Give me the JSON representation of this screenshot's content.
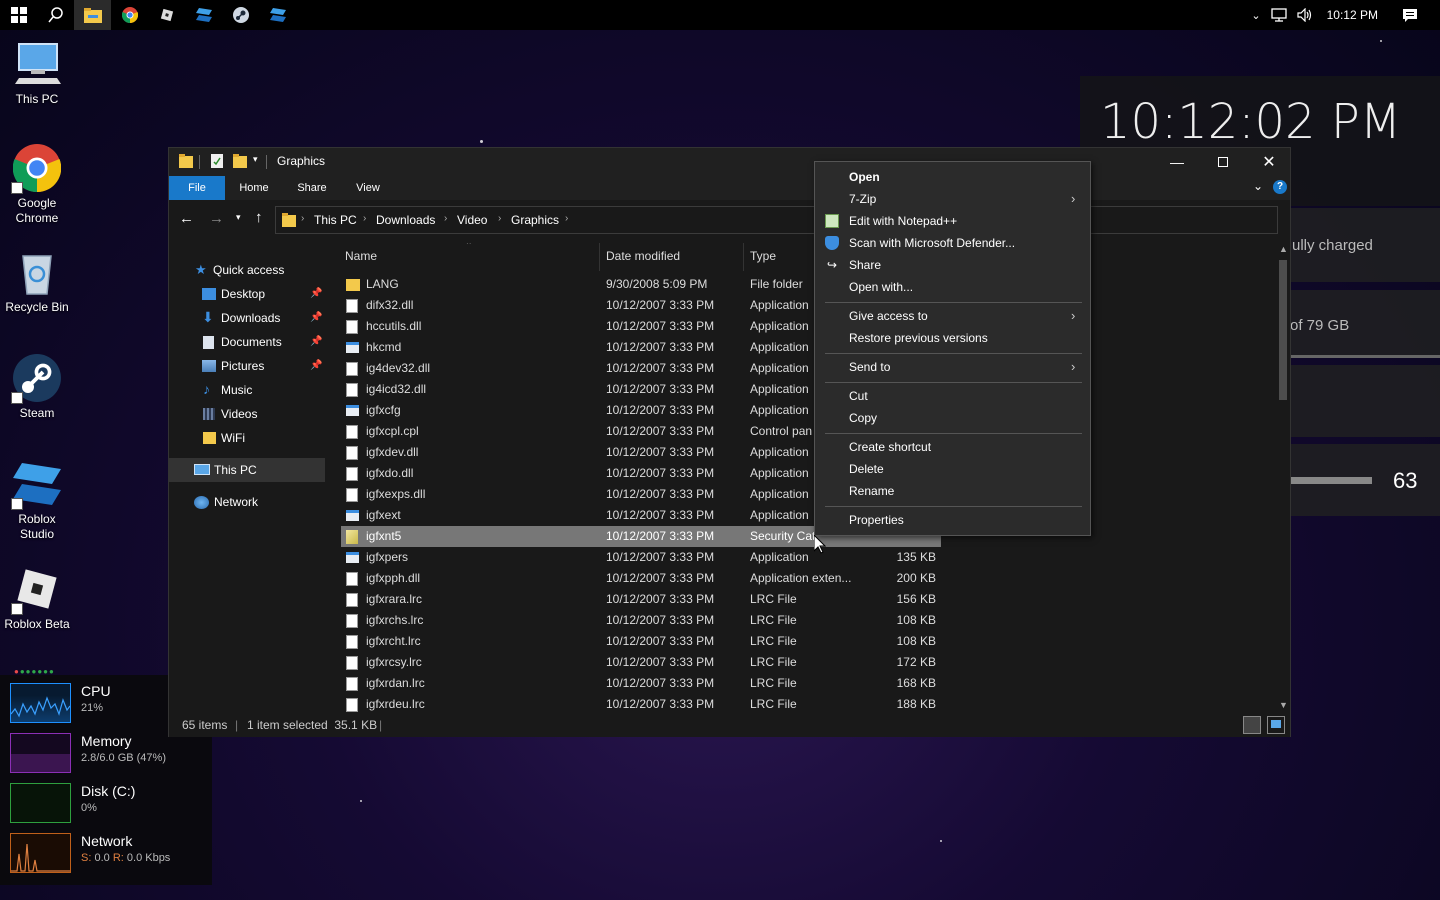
{
  "taskbar": {
    "time": "10:12 PM",
    "apps": [
      "start-icon",
      "search-icon",
      "file-explorer-icon",
      "chrome-icon",
      "roblox-icon",
      "roblox-studio-icon",
      "steam-icon",
      "roblox-studio-icon"
    ]
  },
  "desktop": {
    "icons": [
      {
        "label": "This PC"
      },
      {
        "label": "Google Chrome"
      },
      {
        "label": "Recycle Bin"
      },
      {
        "label": "Steam"
      },
      {
        "label": "Roblox Studio"
      },
      {
        "label": "Roblox Beta"
      }
    ]
  },
  "clock_widget": {
    "time": "10:12:02 PM",
    "battery_text": "ully charged",
    "storage_text": "of 79 GB",
    "volume_value": "63"
  },
  "resmon": {
    "cpu": {
      "name": "CPU",
      "value": "21%",
      "color": "#1e90ff"
    },
    "memory": {
      "name": "Memory",
      "value": "2.8/6.0 GB (47%)",
      "color": "#8b2fb5"
    },
    "disk": {
      "name": "Disk (C:)",
      "value": "0%",
      "color": "#2e9f3e"
    },
    "network": {
      "name": "Network",
      "value_s_label": "S:",
      "value_s": "0.0",
      "value_r_label": "R:",
      "value_r": "0.0 Kbps",
      "color": "#c0601a"
    }
  },
  "explorer": {
    "title": "Graphics",
    "ribbon_tabs": [
      "File",
      "Home",
      "Share",
      "View"
    ],
    "breadcrumb": [
      "This PC",
      "Downloads",
      "Video",
      "Graphics"
    ],
    "nav": {
      "quick_access": "Quick access",
      "items": [
        "Desktop",
        "Downloads",
        "Documents",
        "Pictures",
        "Music",
        "Videos",
        "WiFi"
      ],
      "this_pc": "This PC",
      "network": "Network"
    },
    "columns": {
      "name": "Name",
      "date": "Date modified",
      "type": "Type"
    },
    "files": [
      {
        "name": "LANG",
        "date": "9/30/2008 5:09 PM",
        "type": "File folder",
        "size": "",
        "kind": "folder"
      },
      {
        "name": "difx32.dll",
        "date": "10/12/2007 3:33 PM",
        "type": "Application",
        "size": "",
        "kind": "dll"
      },
      {
        "name": "hccutils.dll",
        "date": "10/12/2007 3:33 PM",
        "type": "Application",
        "size": "",
        "kind": "dll"
      },
      {
        "name": "hkcmd",
        "date": "10/12/2007 3:33 PM",
        "type": "Application",
        "size": "",
        "kind": "exe"
      },
      {
        "name": "ig4dev32.dll",
        "date": "10/12/2007 3:33 PM",
        "type": "Application",
        "size": "",
        "kind": "dll"
      },
      {
        "name": "ig4icd32.dll",
        "date": "10/12/2007 3:33 PM",
        "type": "Application",
        "size": "",
        "kind": "dll"
      },
      {
        "name": "igfxcfg",
        "date": "10/12/2007 3:33 PM",
        "type": "Application",
        "size": "",
        "kind": "exe"
      },
      {
        "name": "igfxcpl.cpl",
        "date": "10/12/2007 3:33 PM",
        "type": "Control pan",
        "size": "",
        "kind": "dll"
      },
      {
        "name": "igfxdev.dll",
        "date": "10/12/2007 3:33 PM",
        "type": "Application",
        "size": "",
        "kind": "dll"
      },
      {
        "name": "igfxdo.dll",
        "date": "10/12/2007 3:33 PM",
        "type": "Application",
        "size": "",
        "kind": "dll"
      },
      {
        "name": "igfxexps.dll",
        "date": "10/12/2007 3:33 PM",
        "type": "Application",
        "size": "",
        "kind": "dll"
      },
      {
        "name": "igfxext",
        "date": "10/12/2007 3:33 PM",
        "type": "Application",
        "size": "",
        "kind": "exe"
      },
      {
        "name": "igfxnt5",
        "date": "10/12/2007 3:33 PM",
        "type": "Security Cat",
        "size": "",
        "kind": "cat",
        "selected": true
      },
      {
        "name": "igfxpers",
        "date": "10/12/2007 3:33 PM",
        "type": "Application",
        "size": "135 KB",
        "kind": "exe"
      },
      {
        "name": "igfxpph.dll",
        "date": "10/12/2007 3:33 PM",
        "type": "Application exten...",
        "size": "200 KB",
        "kind": "dll"
      },
      {
        "name": "igfxrara.lrc",
        "date": "10/12/2007 3:33 PM",
        "type": "LRC File",
        "size": "156 KB",
        "kind": "file"
      },
      {
        "name": "igfxrchs.lrc",
        "date": "10/12/2007 3:33 PM",
        "type": "LRC File",
        "size": "108 KB",
        "kind": "file"
      },
      {
        "name": "igfxrcht.lrc",
        "date": "10/12/2007 3:33 PM",
        "type": "LRC File",
        "size": "108 KB",
        "kind": "file"
      },
      {
        "name": "igfxrcsy.lrc",
        "date": "10/12/2007 3:33 PM",
        "type": "LRC File",
        "size": "172 KB",
        "kind": "file"
      },
      {
        "name": "igfxrdan.lrc",
        "date": "10/12/2007 3:33 PM",
        "type": "LRC File",
        "size": "168 KB",
        "kind": "file"
      },
      {
        "name": "igfxrdeu.lrc",
        "date": "10/12/2007 3:33 PM",
        "type": "LRC File",
        "size": "188 KB",
        "kind": "file"
      }
    ],
    "status": {
      "count": "65 items",
      "selection": "1 item selected  35.1 KB"
    }
  },
  "context_menu": {
    "items": [
      {
        "label": "Open",
        "bold": true
      },
      {
        "label": "7-Zip",
        "submenu": true
      },
      {
        "label": "Edit with Notepad++",
        "icon": "notepad-icon"
      },
      {
        "label": "Scan with Microsoft Defender...",
        "icon": "defender-icon"
      },
      {
        "label": "Share",
        "icon": "share-icon"
      },
      {
        "label": "Open with..."
      },
      {
        "label": "Give access to",
        "submenu": true
      },
      {
        "label": "Restore previous versions"
      },
      {
        "label": "Send to",
        "submenu": true
      },
      {
        "label": "Cut"
      },
      {
        "label": "Copy"
      },
      {
        "label": "Create shortcut"
      },
      {
        "label": "Delete"
      },
      {
        "label": "Rename"
      },
      {
        "label": "Properties"
      }
    ]
  },
  "colors": {
    "accent": "#1979ca",
    "selection": "#777777",
    "folder": "#f3c94b"
  }
}
